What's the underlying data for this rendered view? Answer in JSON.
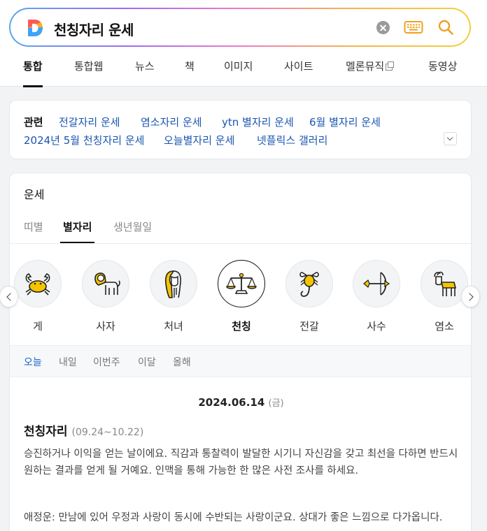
{
  "search": {
    "query": "천칭자리 운세"
  },
  "nav_tabs": [
    "통합",
    "통합웹",
    "뉴스",
    "책",
    "이미지",
    "사이트",
    "멜론뮤직",
    "동영상"
  ],
  "related": {
    "title": "관련",
    "links": [
      "전갈자리 운세",
      "염소자리 운세",
      "ytn 별자리 운세",
      "6월 별자리 운세",
      "2024년 5월 천칭자리 운세",
      "오늘별자리 운세",
      "넷플릭스 갤러리"
    ]
  },
  "fortune": {
    "title": "운세",
    "tabs": [
      "띠별",
      "별자리",
      "생년월일"
    ],
    "zodiac": [
      "게",
      "사자",
      "처녀",
      "천칭",
      "전갈",
      "사수",
      "염소"
    ],
    "periods": [
      "오늘",
      "내일",
      "이번주",
      "이달",
      "올해"
    ],
    "date": "2024.06.14",
    "day_of_week": "(금)",
    "sign": "천칭자리",
    "sign_range": "(09.24~10.22)",
    "text1": "승진하거나 이익을 얻는 날이에요. 직감과 통찰력이 발달한 시기니 자신감을 갖고 최선을 다하면 반드시 원하는 결과를 얻게 될 거예요. 인맥을 통해 가능한 한 많은 사전 조사를 하세요.",
    "text2": "애정운: 만남에 있어 우정과 사랑이 동시에 수반되는 사랑이군요. 상대가 좋은 느낌으로 다가옵니다."
  },
  "colors": {
    "accent_yellow": "#f5c400",
    "link_blue": "#1a56b0",
    "active_period": "#1a66cc"
  }
}
